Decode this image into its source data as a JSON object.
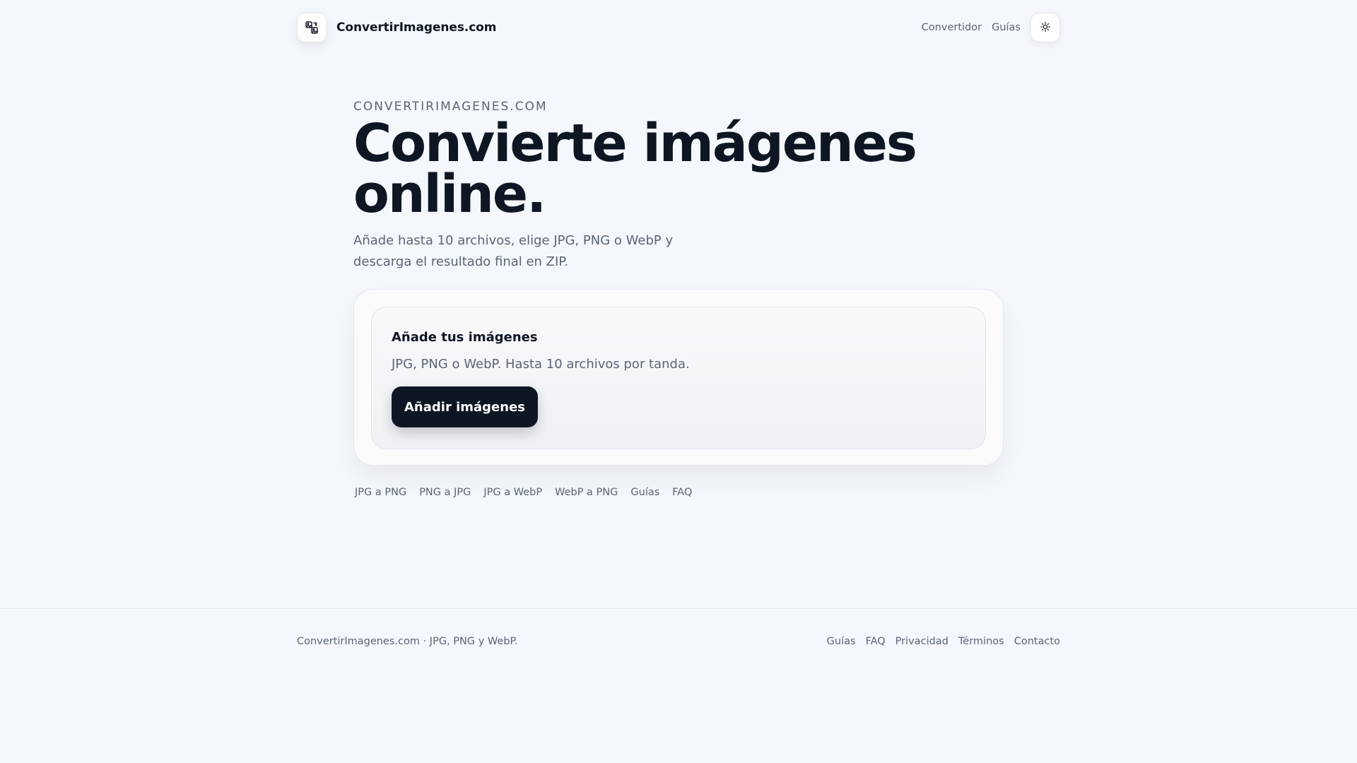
{
  "header": {
    "brand_name": "ConvertirImagenes.com",
    "logo_icon": "image-convert-icon",
    "nav": [
      {
        "label": "Convertidor"
      },
      {
        "label": "Guías"
      }
    ],
    "theme_icon": "sun-icon"
  },
  "hero": {
    "eyebrow": "CONVERTIRIMAGENES.COM",
    "title_line1": "Convierte imágenes",
    "title_line2": "online.",
    "subtitle": "Añade hasta 10 archivos, elige JPG, PNG o WebP y descarga el resultado final en ZIP."
  },
  "upload": {
    "title": "Añade tus imágenes",
    "subtitle": "JPG, PNG o WebP. Hasta 10 archivos por tanda.",
    "button_label": "Añadir imágenes"
  },
  "quick_links": [
    {
      "label": "JPG a PNG"
    },
    {
      "label": "PNG a JPG"
    },
    {
      "label": "JPG a WebP"
    },
    {
      "label": "WebP a PNG"
    },
    {
      "label": "Guías"
    },
    {
      "label": "FAQ"
    }
  ],
  "footer": {
    "text": "ConvertirImagenes.com · JPG, PNG y WebP.",
    "links": [
      {
        "label": "Guías"
      },
      {
        "label": "FAQ"
      },
      {
        "label": "Privacidad"
      },
      {
        "label": "Términos"
      },
      {
        "label": "Contacto"
      }
    ]
  },
  "colors": {
    "background": "#f4f7fb",
    "text_primary": "#0f1623",
    "text_muted": "#5b6574",
    "button_dark": "#0f1623"
  }
}
